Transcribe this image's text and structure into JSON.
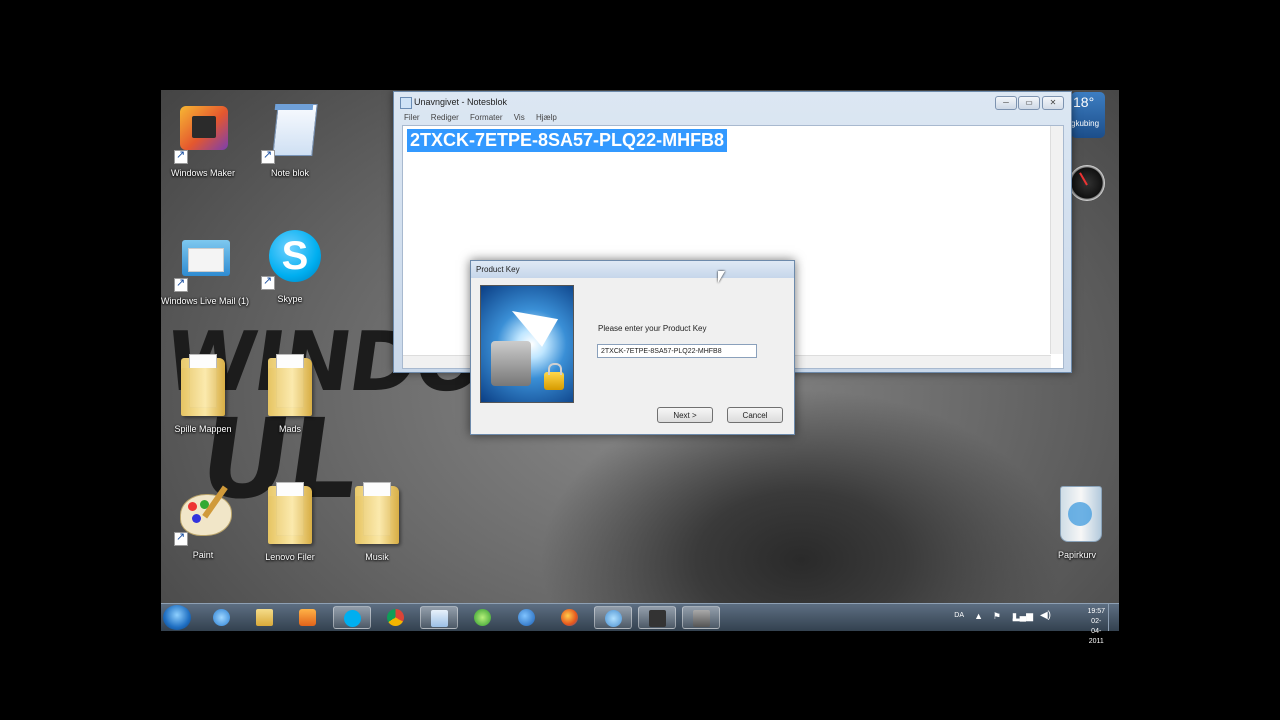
{
  "desktop": {
    "icons": [
      {
        "label": "Windows Maker",
        "kind": "movie"
      },
      {
        "label": "Note blok",
        "kind": "notepad"
      },
      {
        "label": "Windows Live Mail (1)",
        "kind": "mail"
      },
      {
        "label": "Skype",
        "kind": "skype"
      },
      {
        "label": "Spille Mappen",
        "kind": "folder"
      },
      {
        "label": "Mads",
        "kind": "folder"
      },
      {
        "label": "Paint",
        "kind": "paint"
      },
      {
        "label": "Lenovo Filer",
        "kind": "folder"
      },
      {
        "label": "Musik",
        "kind": "folder"
      },
      {
        "label": "Papirkurv",
        "kind": "recycle-bin"
      }
    ],
    "gadget": {
      "temperature": "18°",
      "location": "gkubing"
    }
  },
  "notepad": {
    "title": "Unavngivet - Notesblok",
    "menu": [
      "Filer",
      "Rediger",
      "Formater",
      "Vis",
      "Hjælp"
    ],
    "content": "2TXCK-7ETPE-8SA57-PLQ22-MHFB8",
    "buttons": {
      "minimize": "─",
      "maximize": "▭",
      "close": "✕"
    }
  },
  "dialog": {
    "title": "Product Key",
    "prompt": "Please enter your Product Key",
    "key_value": "2TXCK-7ETPE-8SA57-PLQ22-MHFB8",
    "next_label": "Next >",
    "cancel_label": "Cancel"
  },
  "taskbar": {
    "language": "DA",
    "time": "19:57",
    "date": "02-04-2011"
  },
  "colors": {
    "selection": "#3399ff",
    "taskbar": "#3b4a5a"
  }
}
